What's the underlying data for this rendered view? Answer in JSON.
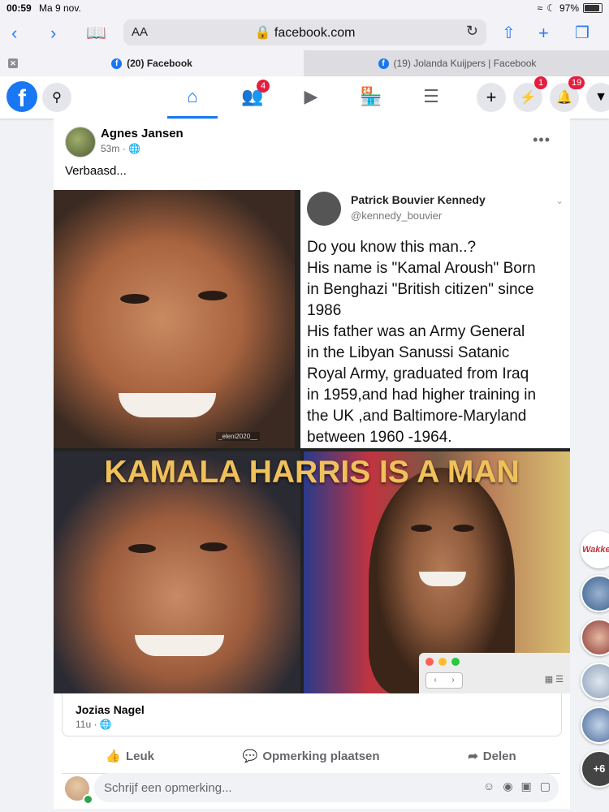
{
  "statusbar": {
    "time": "00:59",
    "date": "Ma 9 nov.",
    "battery": "97%"
  },
  "safari": {
    "aa_label": "AA",
    "url": "facebook.com",
    "icons": [
      "back-icon",
      "forward-icon",
      "book-icon",
      "share-icon",
      "plus-icon",
      "tabs-icon"
    ]
  },
  "tabs": [
    {
      "label": "(20) Facebook",
      "active": true
    },
    {
      "label": "(19) Jolanda Kuijpers | Facebook",
      "active": false
    }
  ],
  "fb_header": {
    "logo": "f",
    "friends_badge": "4",
    "messenger_badge": "1",
    "notifications_badge": "19"
  },
  "post": {
    "author": "Agnes Jansen",
    "time": "53m",
    "text": "Verbaasd...",
    "more": "•••",
    "tweet": {
      "name": "Patrick Bouvier Kennedy",
      "handle": "@kennedy_bouvier",
      "text": "Do you know this man..?\nHis name is \"Kamal Aroush\" Born\nin Benghazi \"British citizen\" since\n1986\nHis father was an Army General\nin the Libyan Sanussi Satanic\nRoyal Army, graduated from Iraq\nin 1959,and had higher training in\nthe UK ,and Baltimore-Maryland\nbetween 1960 -1964."
    },
    "watermark": "_eleni2020__",
    "headline": "KAMALA HARRIS IS A MAN",
    "shared_author": "Jozias Nagel",
    "shared_time": "11u",
    "actions": {
      "like": "Leuk",
      "comment": "Opmerking plaatsen",
      "share": "Delen"
    },
    "comment_placeholder": "Schrijf een opmerking..."
  },
  "chat_bubbles": {
    "first_label": "Wakke",
    "more_label": "+6"
  },
  "colors": {
    "fb_blue": "#1877f2",
    "badge_red": "#e41e3f",
    "headline_gold": "#f0c05a"
  }
}
